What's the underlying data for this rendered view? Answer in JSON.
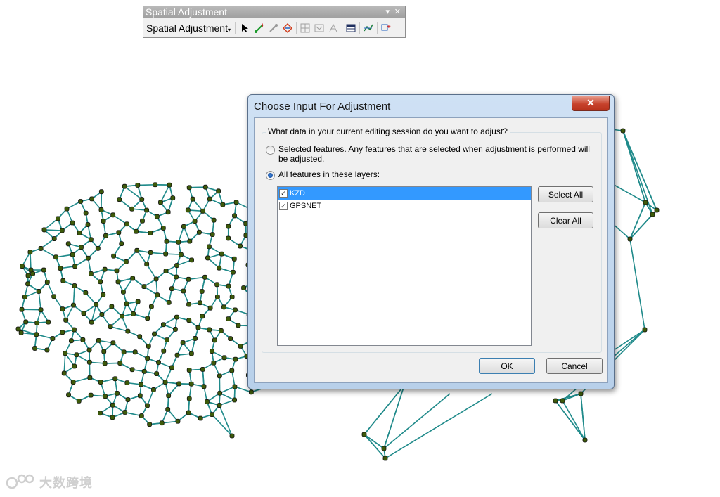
{
  "toolbar": {
    "title": "Spatial Adjustment",
    "menu_label": "Spatial Adjustment",
    "pin_glyph": "▾",
    "close_glyph": "✕",
    "dropdown_glyph": "▾"
  },
  "dialog": {
    "title": "Choose Input For Adjustment",
    "close_glyph": "✕",
    "question": "What data in your current editing session do you want to adjust?",
    "option_selected": "Selected features.  Any features that are selected when adjustment is performed will be adjusted.",
    "option_all": "All features in these layers:",
    "selected_option": "all",
    "layers": [
      {
        "name": "KZD",
        "checked": true,
        "highlighted": true
      },
      {
        "name": "GPSNET",
        "checked": true,
        "highlighted": false
      }
    ],
    "select_all": "Select All",
    "clear_all": "Clear All",
    "ok": "OK",
    "cancel": "Cancel"
  },
  "watermark": {
    "text": "大数跨境"
  },
  "colors": {
    "network_line": "#1f8a8a",
    "network_node": "#4a6a10",
    "node_fill": "#3d5a0a",
    "selection": "#3399ff"
  }
}
